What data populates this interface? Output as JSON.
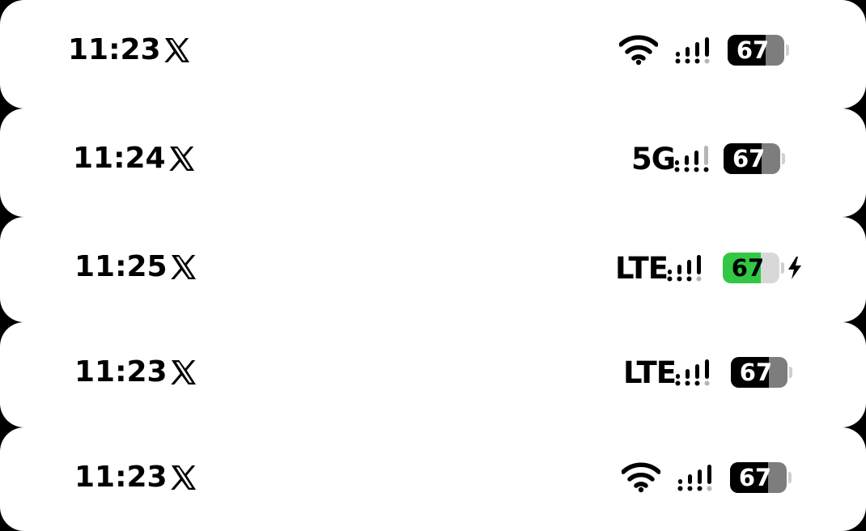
{
  "status_bars": [
    {
      "time": "11:23",
      "app_icon": "x-logo-icon",
      "network": "wifi",
      "network_label": "",
      "battery": {
        "percent": 67,
        "label": "67",
        "charging": false
      }
    },
    {
      "time": "11:24",
      "app_icon": "x-logo-icon",
      "network": "cellular",
      "network_label": "5G",
      "battery": {
        "percent": 67,
        "label": "67",
        "charging": false
      }
    },
    {
      "time": "11:25",
      "app_icon": "x-logo-icon",
      "network": "cellular",
      "network_label": "LTE",
      "battery": {
        "percent": 67,
        "label": "67",
        "charging": true
      }
    },
    {
      "time": "11:23",
      "app_icon": "x-logo-icon",
      "network": "cellular",
      "network_label": "LTE",
      "battery": {
        "percent": 67,
        "label": "67",
        "charging": false
      }
    },
    {
      "time": "11:23",
      "app_icon": "x-logo-icon",
      "network": "wifi",
      "network_label": "",
      "battery": {
        "percent": 67,
        "label": "67",
        "charging": false
      }
    }
  ],
  "colors": {
    "battery_fill": "#000000",
    "battery_empty": "#7d7d7d",
    "battery_charging_fill": "#32c744",
    "signal_inactive": "#b5b5b5"
  }
}
